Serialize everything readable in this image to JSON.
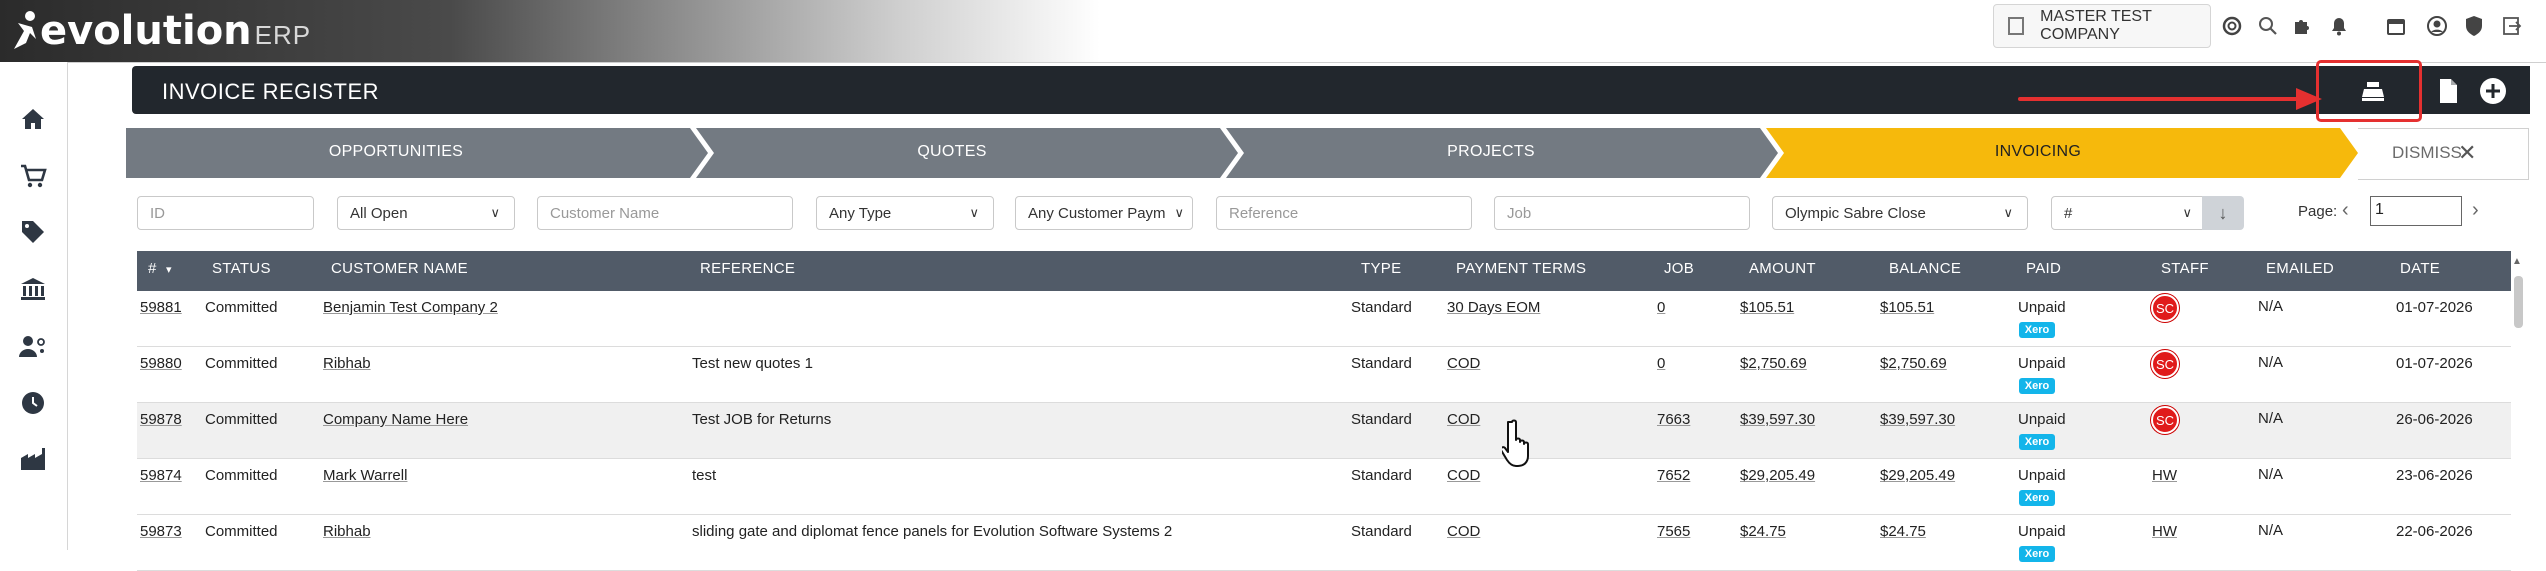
{
  "app": {
    "brand": "evolution",
    "brand_suffix": "ERP"
  },
  "topbar": {
    "company": "MASTER TEST COMPANY",
    "icons": [
      "help-icon",
      "search-icon",
      "puzzle-icon",
      "bell-icon",
      "calendar-icon",
      "user-icon",
      "shield-icon",
      "logout-icon"
    ]
  },
  "sidebar": {
    "items": [
      "home-icon",
      "cart-icon",
      "tag-icon",
      "bank-icon",
      "users-icon",
      "clock-icon",
      "factory-icon"
    ]
  },
  "header": {
    "title": "INVOICE REGISTER",
    "actions": [
      "cash-register-icon",
      "document-icon",
      "add-icon"
    ]
  },
  "stages": [
    {
      "label": "OPPORTUNITIES",
      "active": false
    },
    {
      "label": "QUOTES",
      "active": false
    },
    {
      "label": "PROJECTS",
      "active": false
    },
    {
      "label": "INVOICING",
      "active": true
    }
  ],
  "dismiss_label": "DISMISS",
  "colors": {
    "stage_inactive": "#737a82",
    "stage_active": "#f6b90c",
    "header_bg": "#22272d",
    "table_head": "#515b68",
    "xero": "#13b5ea",
    "staff_badge": "#e01b1b",
    "highlight": "#e53030"
  },
  "filters": {
    "id_placeholder": "ID",
    "status_value": "All Open",
    "customer_placeholder": "Customer Name",
    "type_value": "Any Type",
    "payment_value": "Any Customer Paym",
    "reference_placeholder": "Reference",
    "job_placeholder": "Job",
    "staff_value": "Olympic Sabre Close",
    "sort_value": "#"
  },
  "pagination": {
    "label": "Page:",
    "page": "1"
  },
  "table": {
    "columns": [
      "#",
      "STATUS",
      "CUSTOMER NAME",
      "REFERENCE",
      "TYPE",
      "PAYMENT TERMS",
      "JOB",
      "AMOUNT",
      "BALANCE",
      "PAID",
      "STAFF",
      "EMAILED",
      "DATE"
    ],
    "rows": [
      {
        "num": "59881",
        "status": "Committed",
        "customer": "Benjamin Test Company 2",
        "reference": "",
        "type": "Standard",
        "terms": "30 Days EOM",
        "job": "0",
        "amount": "$105.51",
        "balance": "$105.51",
        "paid": "Unpaid",
        "xero": "Xero",
        "staff": "SC",
        "emailed": "N/A",
        "date": "01-07-2026"
      },
      {
        "num": "59880",
        "status": "Committed",
        "customer": "Ribhab",
        "reference": "Test new quotes 1",
        "type": "Standard",
        "terms": "COD",
        "job": "0",
        "amount": "$2,750.69",
        "balance": "$2,750.69",
        "paid": "Unpaid",
        "xero": "Xero",
        "staff": "SC",
        "emailed": "N/A",
        "date": "01-07-2026"
      },
      {
        "num": "59878",
        "status": "Committed",
        "customer": "Company Name Here",
        "reference": "Test JOB for Returns",
        "type": "Standard",
        "terms": "COD",
        "job": "7663",
        "amount": "$39,597.30",
        "balance": "$39,597.30",
        "paid": "Unpaid",
        "xero": "Xero",
        "staff": "SC",
        "emailed": "N/A",
        "date": "26-06-2026"
      },
      {
        "num": "59874",
        "status": "Committed",
        "customer": "Mark Warrell",
        "reference": "test",
        "type": "Standard",
        "terms": "COD",
        "job": "7652",
        "amount": "$29,205.49",
        "balance": "$29,205.49",
        "paid": "Unpaid",
        "xero": "Xero",
        "staff": "HW",
        "emailed": "N/A",
        "date": "23-06-2026"
      },
      {
        "num": "59873",
        "status": "Committed",
        "customer": "Ribhab",
        "reference": "sliding gate and diplomat fence panels for Evolution Software Systems 2",
        "type": "Standard",
        "terms": "COD",
        "job": "7565",
        "amount": "$24.75",
        "balance": "$24.75",
        "paid": "Unpaid",
        "xero": "Xero",
        "staff": "HW",
        "emailed": "N/A",
        "date": "22-06-2026"
      }
    ]
  }
}
